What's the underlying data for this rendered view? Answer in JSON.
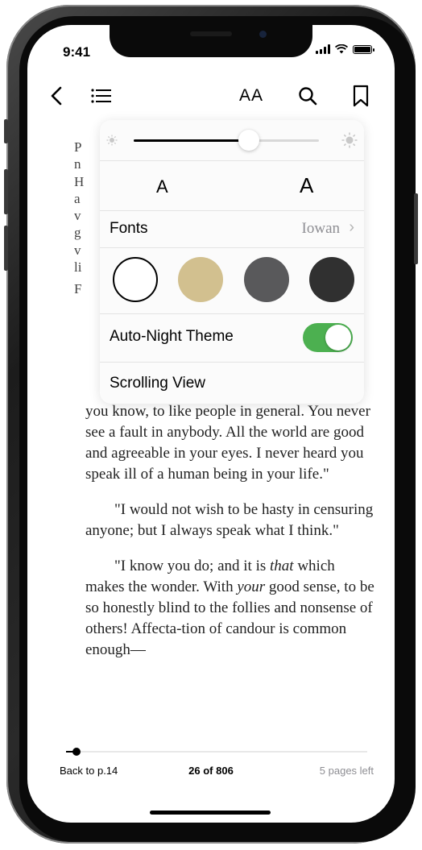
{
  "status": {
    "time": "9:41"
  },
  "toolbar": {
    "back_icon": "chevron-left-icon",
    "contents_icon": "list-icon",
    "text_settings_label": "AA",
    "search_icon": "search-icon",
    "bookmark_icon": "bookmark-icon"
  },
  "popover": {
    "brightness_level": 0.62,
    "font_small_label": "A",
    "font_large_label": "A",
    "fonts_label": "Fonts",
    "fonts_value": "Iowan",
    "fonts_chevron": "›",
    "themes": [
      {
        "name": "White",
        "color": "#ffffff",
        "selected": true
      },
      {
        "name": "Sepia",
        "color": "#d2c08f",
        "selected": false
      },
      {
        "name": "Gray",
        "color": "#59595b",
        "selected": false
      },
      {
        "name": "Night",
        "color": "#303030",
        "selected": false
      }
    ],
    "auto_night_label": "Auto-Night Theme",
    "auto_night_on": true,
    "scrolling_view_label": "Scrolling View"
  },
  "background_fragments": [
    "P",
    "n",
    "H",
    "a",
    "v",
    "g",
    "v",
    "li",
    "F"
  ],
  "page": {
    "paragraphs": [
      "you know, to like people in general. You never see a fault in anybody. All the world are good and agreeable in your eyes. I never heard you speak ill of a human being in your life.\"",
      "\"I would not wish to be hasty in censuring anyone; but I always speak what I think.\""
    ],
    "p3_before_that": "\"I know you do; and it is ",
    "p3_that": "that",
    "p3_after_that": " which makes the wonder. With ",
    "p3_your": "your",
    "p3_rest": " good sense, to be so honestly blind to the follies and nonsense of others! Affecta-tion of candour is common enough—"
  },
  "bottom": {
    "back_to": "Back to p.14",
    "page_position": "26 of 806",
    "pages_left": "5 pages left",
    "progress": 0.03
  },
  "colors": {
    "toggle_on": "#4cb050",
    "secondary_text": "#8e8e93"
  }
}
